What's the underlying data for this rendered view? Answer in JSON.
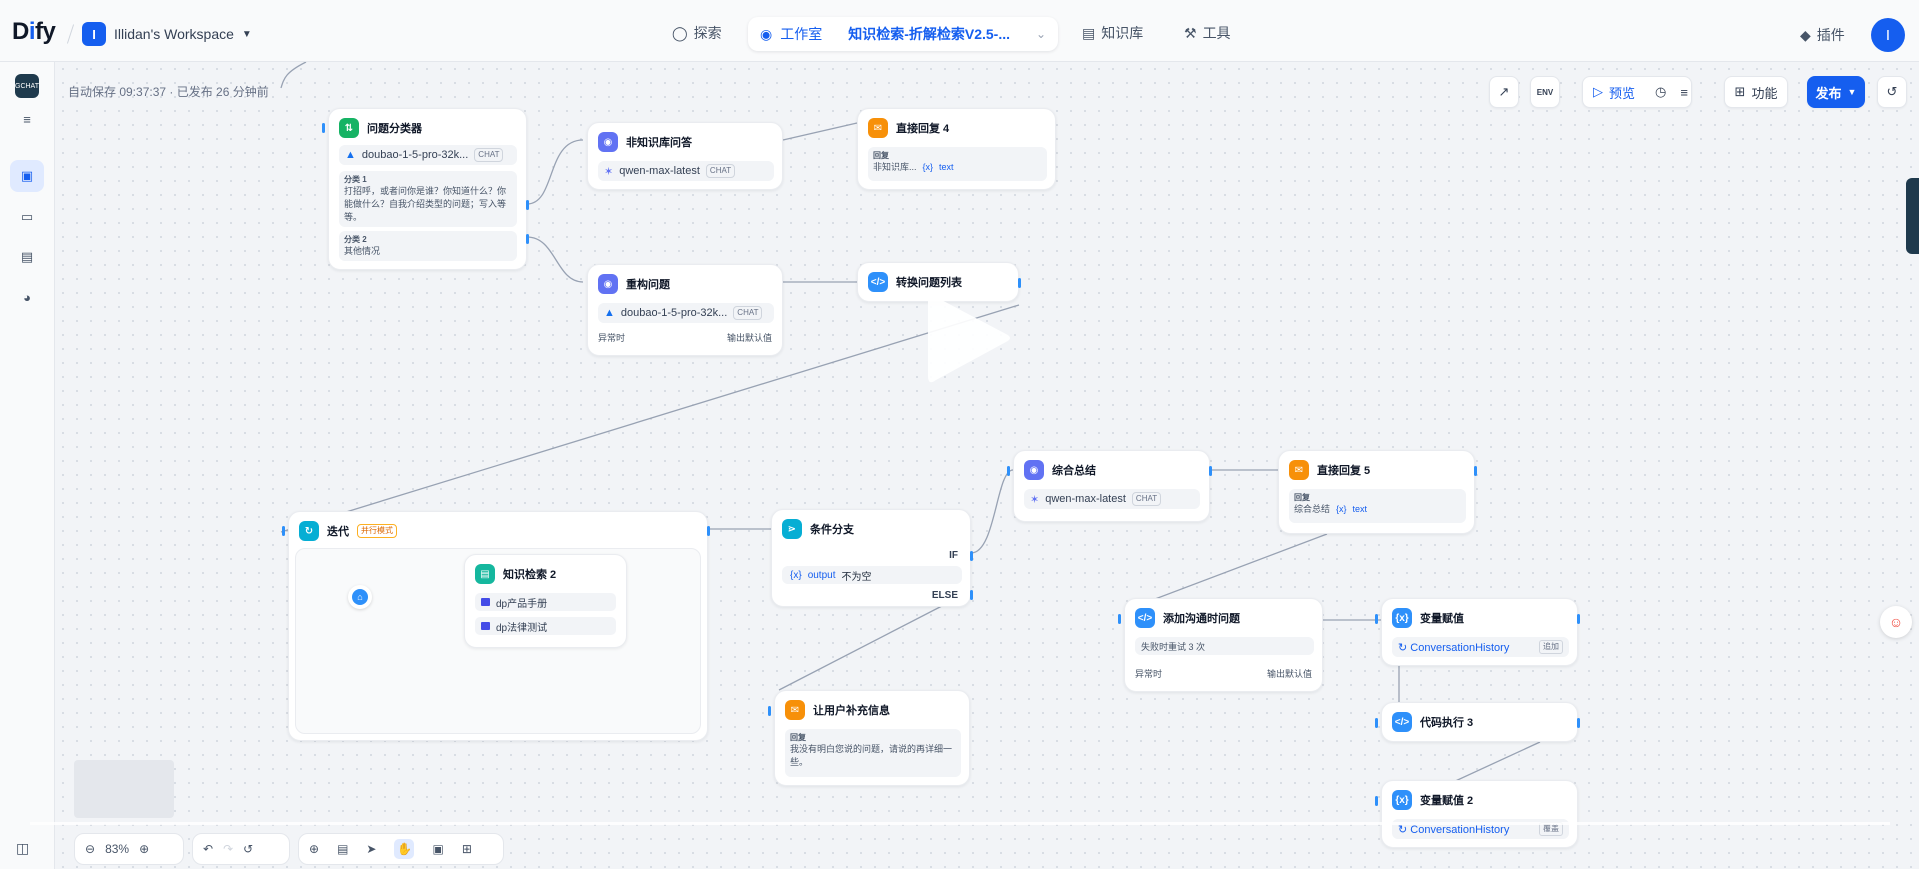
{
  "brand": {
    "logo": "Dify"
  },
  "header": {
    "workspace": {
      "badge": "I",
      "name": "Illidan's Workspace"
    },
    "nav": [
      {
        "label": "探索"
      },
      {
        "label": "工作室"
      },
      {
        "label": "知识库"
      },
      {
        "label": "工具"
      }
    ],
    "current_app": "知识检索-折解检索V2.5-...",
    "plugin_label": "插件",
    "avatar": "I"
  },
  "left_rail": {
    "app_icon_text": "GCHAT"
  },
  "canvas": {
    "autosave_text": "自动保存 09:37:37 · 已发布 26 分钟前",
    "toolbar": {
      "env_label": "ENV",
      "preview_label": "预览",
      "features_label": "功能",
      "publish_label": "发布"
    }
  },
  "nodes": {
    "classifier": {
      "title": "问题分类器",
      "model": "doubao-1-5-pro-32k...",
      "tag": "CHAT",
      "class1_label": "分类 1",
      "class1_text": "打招呼，或者问你是谁？你知道什么？你能做什么？自我介绍类型的问题；写入等等。",
      "class2_label": "分类 2",
      "class2_text": "其他情况"
    },
    "non_kb_qa": {
      "title": "非知识库问答",
      "model": "qwen-max-latest",
      "tag": "CHAT"
    },
    "reply4": {
      "title": "直接回复 4",
      "label": "回复",
      "content_node": "非知识库...",
      "content_var": "text"
    },
    "rebuild": {
      "title": "重构问题",
      "model": "doubao-1-5-pro-32k...",
      "tag": "CHAT",
      "error_label": "异常时",
      "error_value": "输出默认值"
    },
    "to_list": {
      "title": "转换问题列表"
    },
    "iteration": {
      "title": "迭代",
      "badge": "并行模式"
    },
    "kb_search": {
      "title": "知识检索 2",
      "datasets": [
        "dp产品手册",
        "dp法律测试"
      ]
    },
    "branch": {
      "title": "条件分支",
      "if_label": "IF",
      "cond_var": "output",
      "cond_op": "不为空",
      "else_label": "ELSE"
    },
    "summary": {
      "title": "综合总结",
      "model": "qwen-max-latest",
      "tag": "CHAT"
    },
    "reply5": {
      "title": "直接回复 5",
      "label": "回复",
      "content_node": "综合总结",
      "content_var": "text"
    },
    "add_history": {
      "title": "添加沟通时问题",
      "retry_text": "失败时重试 3 次",
      "error_label": "异常时",
      "error_value": "输出默认值"
    },
    "assign1": {
      "title": "变量赋值",
      "var": "ConversationHistory",
      "op": "追加"
    },
    "ask_user": {
      "title": "让用户补充信息",
      "label": "回复",
      "text": "我没有明白您说的问题，请说的再详细一些。"
    },
    "code3": {
      "title": "代码执行 3"
    },
    "assign2": {
      "title": "变量赋值 2",
      "var": "ConversationHistory",
      "op": "覆盖"
    }
  },
  "bottom_controls": {
    "zoom": "83%"
  }
}
